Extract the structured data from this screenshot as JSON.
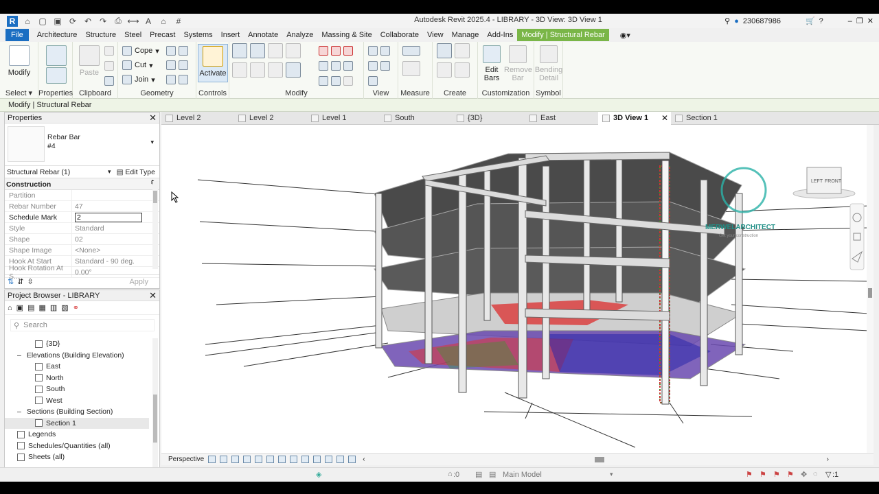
{
  "app": {
    "title": "Autodesk Revit 2025.4 - LIBRARY - 3D View: 3D View 1",
    "user": "230687986"
  },
  "ribbon_tabs": [
    "File",
    "Architecture",
    "Structure",
    "Steel",
    "Precast",
    "Systems",
    "Insert",
    "Annotate",
    "Analyze",
    "Massing & Site",
    "Collaborate",
    "View",
    "Manage",
    "Add-Ins",
    "Modify | Structural Rebar"
  ],
  "ribbon": {
    "select_label": "Select",
    "modify_label": "Modify",
    "properties_label": "Properties",
    "paste_label": "Paste",
    "clipboard_label": "Clipboard",
    "cope_label": "Cope",
    "cut_label": "Cut",
    "join_label": "Join",
    "geometry_label": "Geometry",
    "activate_label": "Activate",
    "controls_label": "Controls",
    "modify_panel_label": "Modify",
    "view_label": "View",
    "measure_label": "Measure",
    "create_label": "Create",
    "edit_bars_label": "Edit Bars",
    "remove_bar_label": "Remove Bar",
    "bending_detail_label": "Bending Detail",
    "customization_label": "Customization",
    "symbol_label": "Symbol"
  },
  "context_bar": "Modify | Structural Rebar",
  "properties": {
    "header": "Properties",
    "type_name": "Rebar Bar",
    "type_sub": "#4",
    "selector": "Structural Rebar (1)",
    "edit_type": "Edit Type",
    "section": "Construction",
    "rows": [
      {
        "k": "Partition",
        "v": ""
      },
      {
        "k": "Rebar Number",
        "v": "47"
      },
      {
        "k": "Schedule Mark",
        "v": "2"
      },
      {
        "k": "Style",
        "v": "Standard"
      },
      {
        "k": "Shape",
        "v": "02"
      },
      {
        "k": "Shape Image",
        "v": "<None>"
      },
      {
        "k": "Hook At Start",
        "v": "Standard - 90 deg."
      },
      {
        "k": "Hook Rotation At S...",
        "v": "0.00°"
      }
    ],
    "apply": "Apply"
  },
  "project_browser": {
    "header": "Project Browser - LIBRARY",
    "search_placeholder": "Search",
    "items": [
      "{3D}",
      "Elevations (Building Elevation)",
      "East",
      "North",
      "South",
      "West",
      "Sections (Building Section)",
      "Section 1",
      "Legends",
      "Schedules/Quantities (all)",
      "Sheets (all)"
    ]
  },
  "view_tabs": [
    "Level 2",
    "Level 2",
    "Level 1",
    "South",
    "{3D}",
    "East",
    "3D View 1",
    "Section 1"
  ],
  "viewcube": {
    "left": "LEFT",
    "front": "FRONT"
  },
  "watermark": {
    "brand": "MERWELARCHITECT",
    "tagline": "Get your construction"
  },
  "view_control": {
    "perspective": "Perspective"
  },
  "status": {
    "zero": ":0",
    "model": "Main Model",
    "filter": ":1"
  }
}
